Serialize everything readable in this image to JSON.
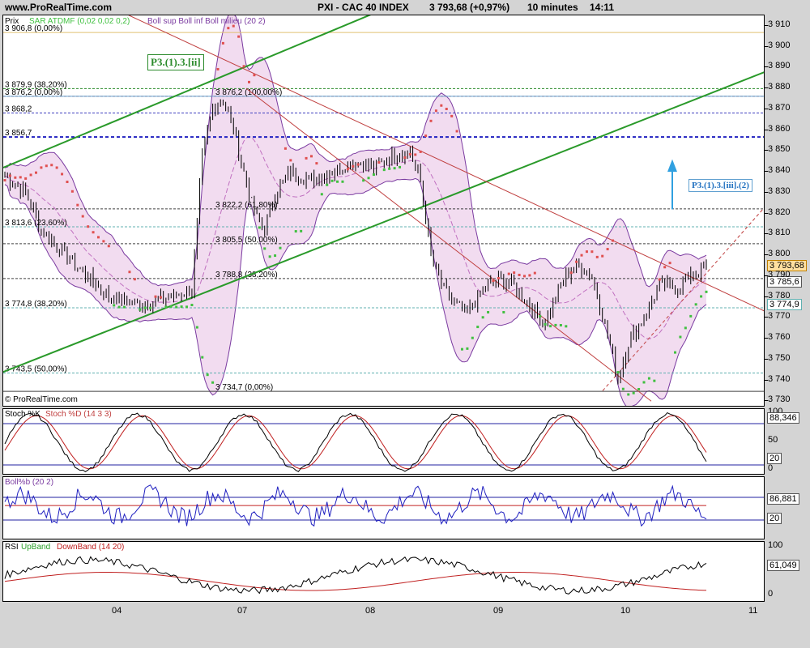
{
  "header": {
    "site": "www.ProRealTime.com",
    "instrument": "PXI - CAC 40 INDEX",
    "price": "3 793,68 (+0,97%)",
    "timeframe": "10 minutes",
    "time": "14:11"
  },
  "main_panel": {
    "label_prix": "Prix",
    "legend_sar": "SAR ATDMF (0,02 0,02 0,2)",
    "legend_boll": "Boll sup Boll inf Boll milieu (20 2)",
    "copyright": "© ProRealTime.com",
    "wave_label_1": "P3.(1).3.[ii]",
    "wave_label_2": "P3.(1).3.[iii].(2)",
    "price_tags": [
      "3 793,68",
      "3 785,6",
      "3 774,9"
    ],
    "level_labels": [
      {
        "text": "3 906,8 (0,00%)",
        "value": 3906.8,
        "color": "#e0c070",
        "style": "solid"
      },
      {
        "text": "3 879,9 (38,20%)",
        "value": 3879.9,
        "color": "#2a8a2a",
        "style": "dash"
      },
      {
        "text": "3 876,2 (0,00%)",
        "value": 3876.2,
        "color": "#b03030",
        "style": "dash"
      },
      {
        "text": "3 876,2 (100,00%)",
        "value": 3876.2,
        "color": "#60a0d0",
        "style": "solid"
      },
      {
        "text": "3 868,2",
        "value": 3868.2,
        "color": "#4040c0",
        "style": "dash"
      },
      {
        "text": "3 856,7",
        "value": 3856.7,
        "color": "#2020c0",
        "style": "dashbold"
      },
      {
        "text": "3 822,2 (61,80%)",
        "value": 3822.2,
        "color": "#404040",
        "style": "dash"
      },
      {
        "text": "3 813,6 (23,60%)",
        "value": 3813.6,
        "color": "#60b0b0",
        "style": "dash"
      },
      {
        "text": "3 805,5 (50,00%)",
        "value": 3805.5,
        "color": "#404040",
        "style": "dash"
      },
      {
        "text": "3 788,8 (38,20%)",
        "value": 3788.8,
        "color": "#404040",
        "style": "dash"
      },
      {
        "text": "3 774,8 (38,20%)",
        "value": 3774.8,
        "color": "#60b0b0",
        "style": "dash"
      },
      {
        "text": "3 743,5 (50,00%)",
        "value": 3743.5,
        "color": "#60b0b0",
        "style": "dash"
      },
      {
        "text": "3 734,7 (0,00%)",
        "value": 3734.7,
        "color": "#404040",
        "style": "solid"
      }
    ]
  },
  "stoch_panel": {
    "title_k": "Stoch %K",
    "title_d": "Stoch %D (14 3 3)",
    "value_tag": "88,346",
    "ticks": [
      "100",
      "50",
      "0"
    ],
    "level_tag": "20"
  },
  "boll_panel": {
    "title": "Boll%b (20 2)",
    "value_tag": "86,881",
    "level_tag": "20"
  },
  "rsi_panel": {
    "title_rsi": "RSI",
    "title_up": "UpBand",
    "title_down": "DownBand (14 20)",
    "value_tag": "61,049",
    "ticks": [
      "100",
      "0"
    ]
  },
  "colors": {
    "up_sar": "#40c040",
    "down_sar": "#e05050",
    "bands": "#7a3aa0",
    "band_fill": "#f2dcf0",
    "trend_green": "#2a9a2a",
    "channel_red": "#c04040"
  },
  "chart_data": {
    "type": "candlestick",
    "y_axis_ticks": [
      "3 910",
      "3 900",
      "3 890",
      "3 880",
      "3 870",
      "3 860",
      "3 850",
      "3 840",
      "3 830",
      "3 820",
      "3 810",
      "3 800",
      "3 790",
      "3 780",
      "3 770",
      "3 760",
      "3 750",
      "3 740",
      "3 730"
    ],
    "ylim": [
      3727,
      3915
    ],
    "x_axis_ticks": [
      "04",
      "07",
      "08",
      "09",
      "10",
      "11"
    ],
    "close_path": [
      {
        "x": 0,
        "y": 3838
      },
      {
        "x": 8,
        "y": 3830
      },
      {
        "x": 14,
        "y": 3812
      },
      {
        "x": 22,
        "y": 3802
      },
      {
        "x": 30,
        "y": 3792
      },
      {
        "x": 40,
        "y": 3780
      },
      {
        "x": 52,
        "y": 3776
      },
      {
        "x": 64,
        "y": 3780
      },
      {
        "x": 72,
        "y": 3783
      },
      {
        "x": 76,
        "y": 3848
      },
      {
        "x": 80,
        "y": 3870
      },
      {
        "x": 84,
        "y": 3875
      },
      {
        "x": 88,
        "y": 3860
      },
      {
        "x": 92,
        "y": 3840
      },
      {
        "x": 96,
        "y": 3820
      },
      {
        "x": 100,
        "y": 3812
      },
      {
        "x": 104,
        "y": 3830
      },
      {
        "x": 110,
        "y": 3840
      },
      {
        "x": 118,
        "y": 3836
      },
      {
        "x": 126,
        "y": 3840
      },
      {
        "x": 134,
        "y": 3845
      },
      {
        "x": 142,
        "y": 3842
      },
      {
        "x": 150,
        "y": 3848
      },
      {
        "x": 156,
        "y": 3850
      },
      {
        "x": 160,
        "y": 3835
      },
      {
        "x": 164,
        "y": 3800
      },
      {
        "x": 168,
        "y": 3786
      },
      {
        "x": 172,
        "y": 3778
      },
      {
        "x": 178,
        "y": 3772
      },
      {
        "x": 184,
        "y": 3784
      },
      {
        "x": 190,
        "y": 3788
      },
      {
        "x": 196,
        "y": 3785
      },
      {
        "x": 202,
        "y": 3776
      },
      {
        "x": 208,
        "y": 3768
      },
      {
        "x": 214,
        "y": 3786
      },
      {
        "x": 220,
        "y": 3796
      },
      {
        "x": 226,
        "y": 3790
      },
      {
        "x": 232,
        "y": 3762
      },
      {
        "x": 236,
        "y": 3740
      },
      {
        "x": 240,
        "y": 3758
      },
      {
        "x": 246,
        "y": 3770
      },
      {
        "x": 252,
        "y": 3786
      },
      {
        "x": 258,
        "y": 3784
      },
      {
        "x": 264,
        "y": 3790
      },
      {
        "x": 270,
        "y": 3794
      }
    ]
  }
}
